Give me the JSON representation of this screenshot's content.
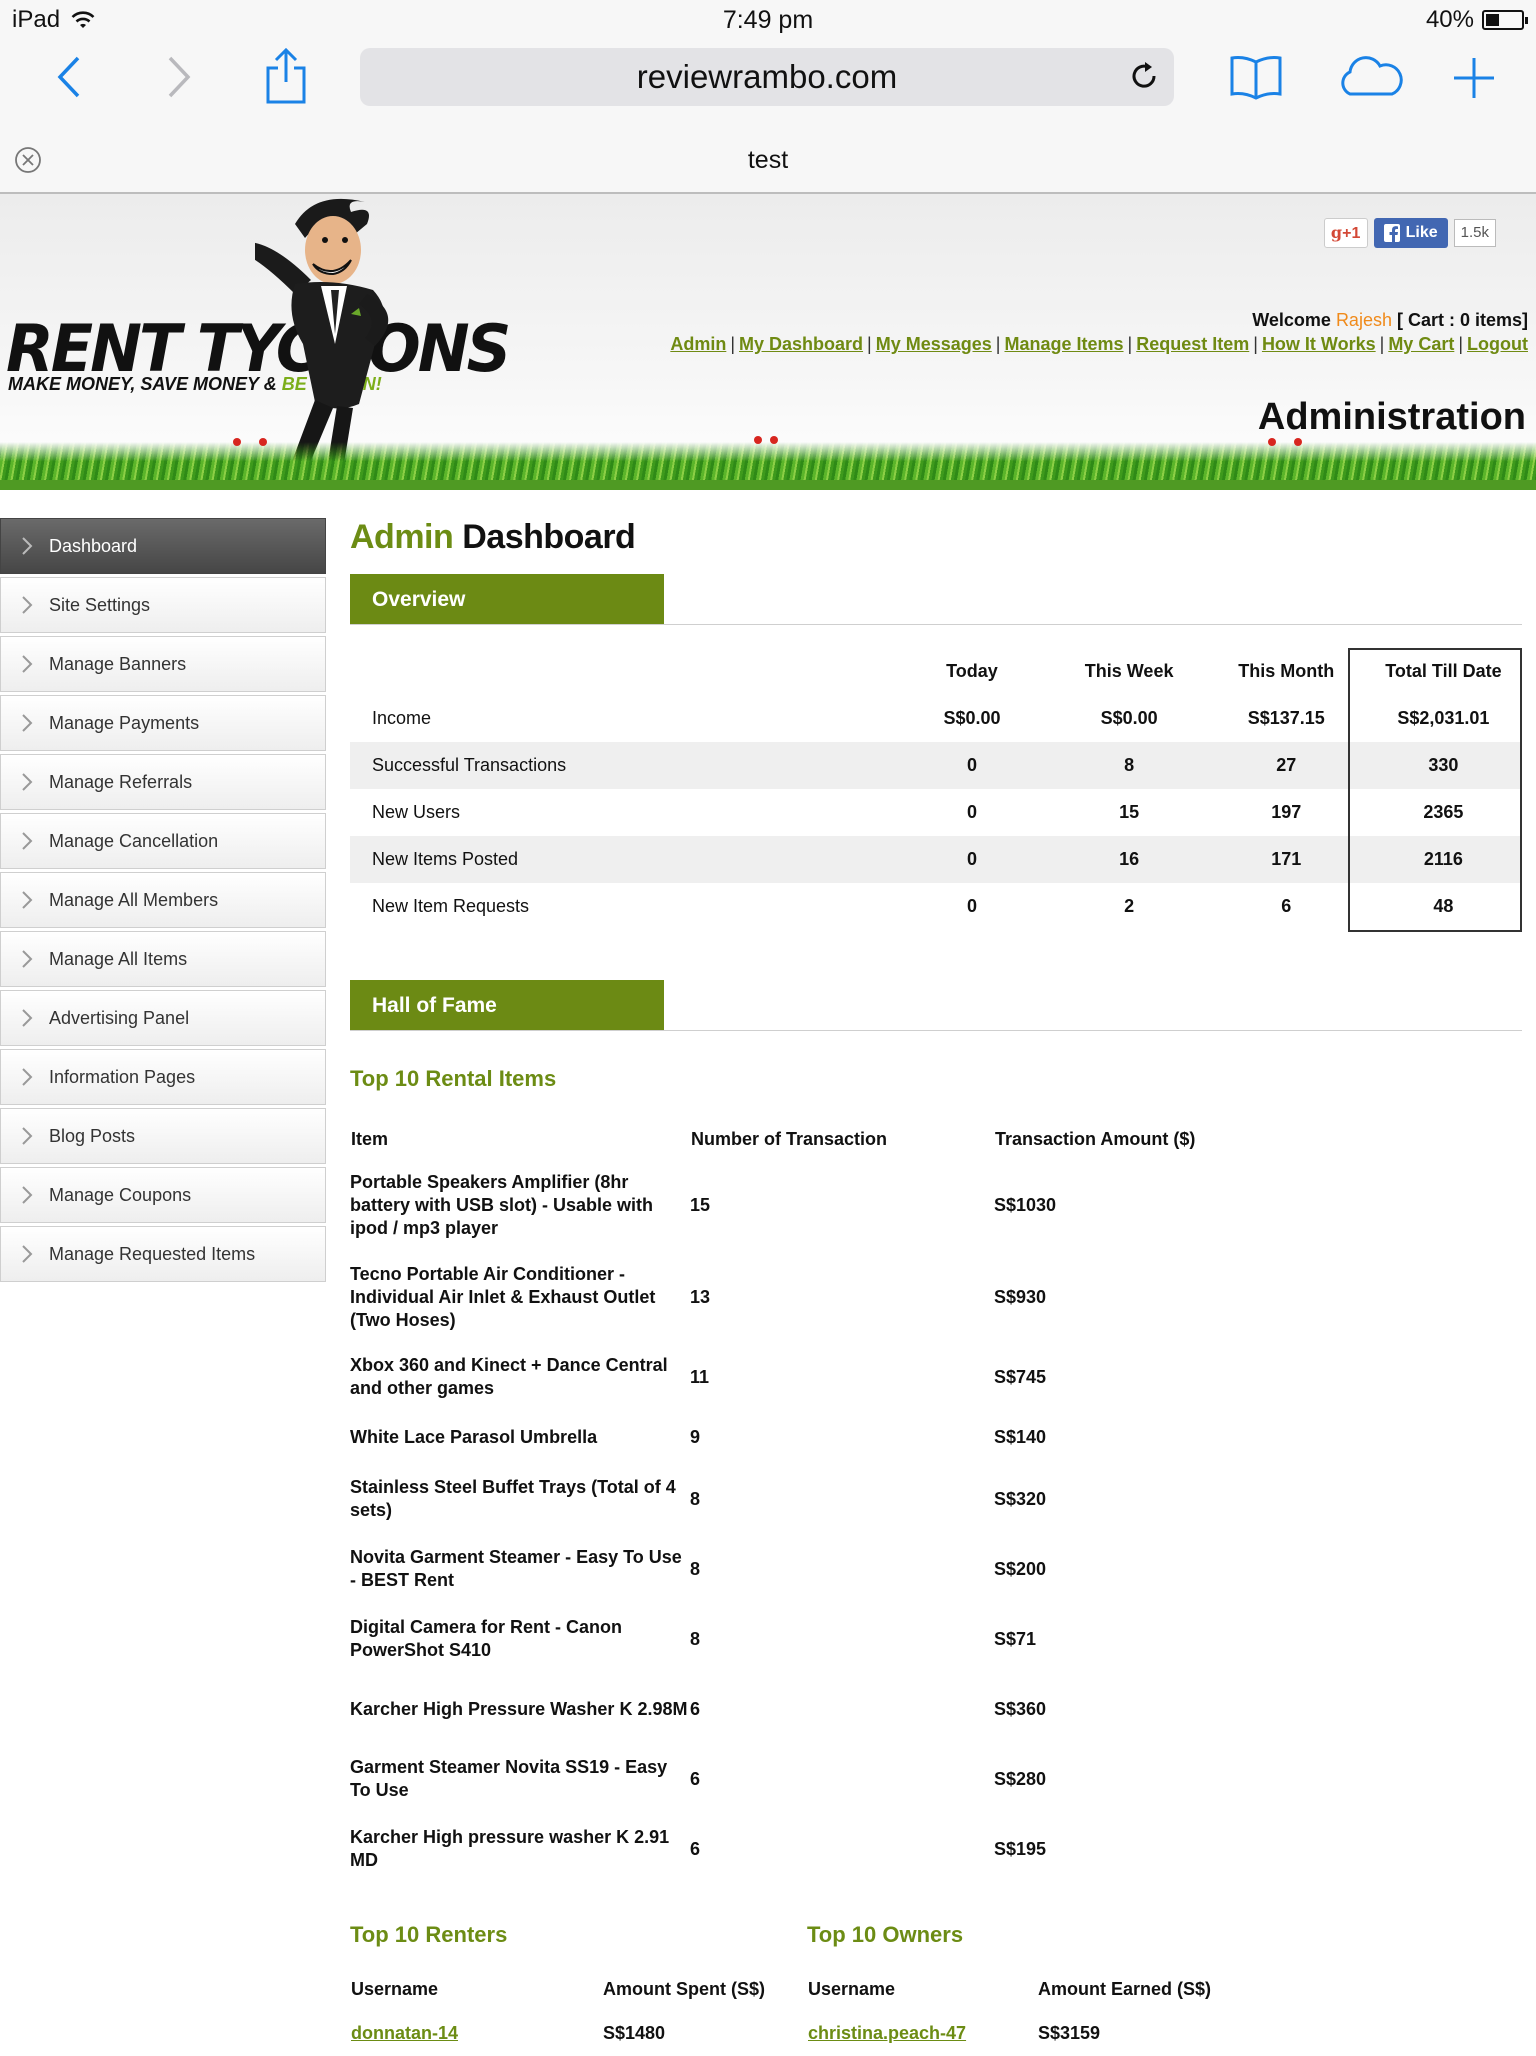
{
  "status": {
    "device": "iPad",
    "time": "7:49 pm",
    "battery": "40%"
  },
  "browser": {
    "url": "reviewrambo.com",
    "tab_title": "test"
  },
  "header": {
    "logo_main": "RENT TYCOONS",
    "logo_sub_dark": "MAKE MONEY, SAVE MONEY & ",
    "logo_sub_green": "BE GREEN!",
    "gplus": "+1",
    "fb_like": "Like",
    "fb_count": "1.5k",
    "welcome_prefix": "Welcome ",
    "welcome_user": "Rajesh",
    "cart": " [ Cart : 0 items]",
    "nav": [
      "Admin",
      "My Dashboard",
      "My Messages",
      "Manage Items",
      "Request Item",
      "How It Works",
      "My Cart",
      "Logout"
    ],
    "page_heading": "Administration"
  },
  "sidebar": {
    "items": [
      {
        "label": "Dashboard",
        "active": true
      },
      {
        "label": "Site Settings"
      },
      {
        "label": "Manage Banners"
      },
      {
        "label": "Manage Payments"
      },
      {
        "label": "Manage Referrals"
      },
      {
        "label": "Manage Cancellation"
      },
      {
        "label": "Manage All Members"
      },
      {
        "label": "Manage All Items"
      },
      {
        "label": "Advertising Panel"
      },
      {
        "label": "Information Pages"
      },
      {
        "label": "Blog Posts"
      },
      {
        "label": "Manage Coupons"
      },
      {
        "label": "Manage Requested Items"
      }
    ]
  },
  "main": {
    "title_part1": "Admin",
    "title_part2": " Dashboard",
    "overview": {
      "tab": "Overview",
      "columns": [
        "Today",
        "This Week",
        "This Month",
        "Total Till Date"
      ],
      "rows": [
        {
          "label": "Income",
          "values": [
            "S$0.00",
            "S$0.00",
            "S$137.15",
            "S$2,031.01"
          ]
        },
        {
          "label": "Successful Transactions",
          "values": [
            "0",
            "8",
            "27",
            "330"
          ]
        },
        {
          "label": "New Users",
          "values": [
            "0",
            "15",
            "197",
            "2365"
          ]
        },
        {
          "label": "New Items Posted",
          "values": [
            "0",
            "16",
            "171",
            "2116"
          ]
        },
        {
          "label": "New Item Requests",
          "values": [
            "0",
            "2",
            "6",
            "48"
          ]
        }
      ]
    },
    "hall_of_fame": {
      "tab": "Hall of Fame",
      "top_items_title": "Top 10 Rental Items",
      "top_items_columns": [
        "Item",
        "Number of Transaction",
        "Transaction Amount ($)"
      ],
      "top_items": [
        {
          "item": "Portable Speakers Amplifier (8hr battery with USB slot) - Usable with ipod / mp3 player",
          "count": "15",
          "amount": "S$1030"
        },
        {
          "item": "Tecno Portable Air Conditioner - Individual Air Inlet & Exhaust Outlet (Two Hoses)",
          "count": "13",
          "amount": "S$930"
        },
        {
          "item": "Xbox 360 and Kinect + Dance Central and other games",
          "count": "11",
          "amount": "S$745"
        },
        {
          "item": "White Lace Parasol Umbrella",
          "count": "9",
          "amount": "S$140"
        },
        {
          "item": "Stainless Steel Buffet Trays (Total of 4 sets)",
          "count": "8",
          "amount": "S$320"
        },
        {
          "item": "Novita Garment Steamer - Easy To Use - BEST Rent",
          "count": "8",
          "amount": "S$200"
        },
        {
          "item": "Digital Camera for Rent - Canon PowerShot S410",
          "count": "8",
          "amount": "S$71"
        },
        {
          "item": "Karcher High Pressure Washer K 2.98M",
          "count": "6",
          "amount": "S$360"
        },
        {
          "item": "Garment Steamer Novita SS19 - Easy To Use",
          "count": "6",
          "amount": "S$280"
        },
        {
          "item": "Karcher High pressure washer K 2.91 MD",
          "count": "6",
          "amount": "S$195"
        }
      ],
      "renters_title": "Top 10 Renters",
      "renters_columns": [
        "Username",
        "Amount Spent (S$)"
      ],
      "renters": [
        {
          "username": "donnatan-14",
          "amount": "S$1480"
        }
      ],
      "owners_title": "Top 10 Owners",
      "owners_columns": [
        "Username",
        "Amount Earned (S$)"
      ],
      "owners": [
        {
          "username": "christina.peach-47",
          "amount": "S$3159"
        }
      ]
    }
  },
  "colors": {
    "accent_green": "#6c8a14",
    "link_green": "#6f8a12",
    "welcome_user": "#f08a1a",
    "safari_blue": "#1a82e6"
  }
}
